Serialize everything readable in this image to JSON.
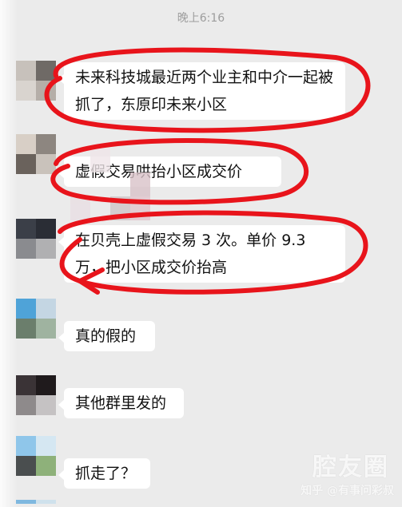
{
  "status": {
    "time": "晚上6:16"
  },
  "messages": [
    {
      "text": "未来科技城最近两个业主和中介一起被抓了，东原印未来小区"
    },
    {
      "text": "虚假交易哄抬小区成交价"
    },
    {
      "text": "在贝壳上虚假交易 3 次。单价 9.3 万，把小区成交价抬高"
    },
    {
      "text": "真的假的"
    },
    {
      "text": "其他群里发的"
    },
    {
      "text": "抓走了？"
    }
  ],
  "watermark": {
    "brand": "腔友圈",
    "source": "知乎 @有事问彩叔"
  },
  "colors": {
    "annotation": "#e8141b",
    "bubble": "#ffffff",
    "background": "#ebebeb"
  }
}
